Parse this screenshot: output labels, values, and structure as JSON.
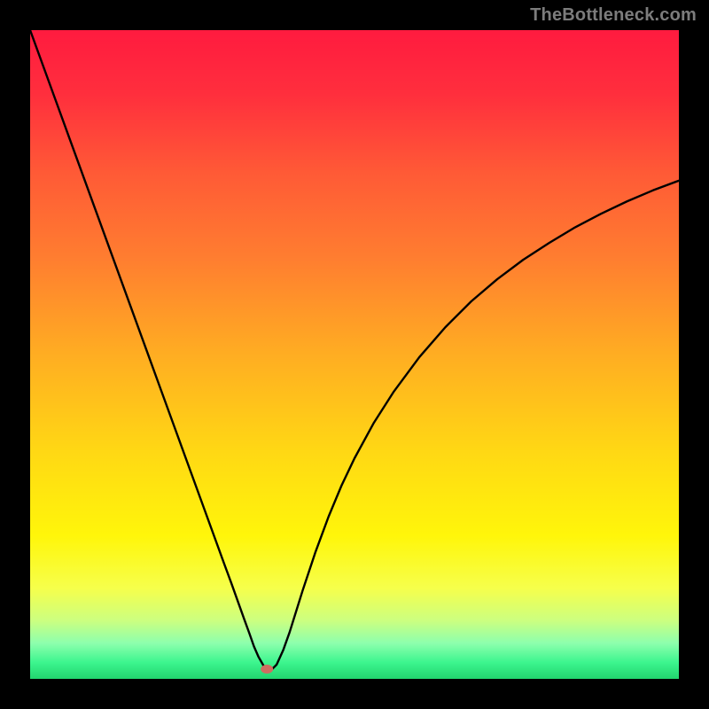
{
  "watermark": "TheBottleneck.com",
  "colors": {
    "frame": "#000000",
    "curve": "#000000",
    "marker": "#cf6d60",
    "gradient_stops": [
      {
        "offset": 0.0,
        "color": "#ff1b3f"
      },
      {
        "offset": 0.1,
        "color": "#ff2f3d"
      },
      {
        "offset": 0.22,
        "color": "#ff5a36"
      },
      {
        "offset": 0.35,
        "color": "#ff7d30"
      },
      {
        "offset": 0.5,
        "color": "#ffad22"
      },
      {
        "offset": 0.65,
        "color": "#ffd814"
      },
      {
        "offset": 0.78,
        "color": "#fff60a"
      },
      {
        "offset": 0.86,
        "color": "#f6ff4b"
      },
      {
        "offset": 0.91,
        "color": "#ccff80"
      },
      {
        "offset": 0.945,
        "color": "#8dffad"
      },
      {
        "offset": 0.975,
        "color": "#3cf58e"
      },
      {
        "offset": 1.0,
        "color": "#22d56e"
      }
    ]
  },
  "chart_data": {
    "type": "line",
    "title": "",
    "xlabel": "",
    "ylabel": "",
    "xlim": [
      0,
      100
    ],
    "ylim": [
      0,
      100
    ],
    "marker": {
      "x": 36.5,
      "y": 1.5
    },
    "series": [
      {
        "name": "bottleneck-curve",
        "x": [
          0,
          2,
          4,
          6,
          8,
          10,
          12,
          14,
          16,
          18,
          20,
          22,
          24,
          26,
          28,
          30,
          31,
          32,
          33,
          33.8,
          34.5,
          35.2,
          36,
          36.5,
          37,
          38,
          39,
          40,
          41,
          42,
          44,
          46,
          48,
          50,
          53,
          56,
          60,
          64,
          68,
          72,
          76,
          80,
          84,
          88,
          92,
          96,
          100
        ],
        "y": [
          100,
          94.5,
          89,
          83.5,
          78,
          72.5,
          67,
          61.5,
          56,
          50.5,
          45,
          39.5,
          34,
          28.5,
          23,
          17.5,
          14.8,
          12,
          9.2,
          7,
          5,
          3.4,
          2,
          1.3,
          1.2,
          2.2,
          4.4,
          7.2,
          10.4,
          13.6,
          19.6,
          25,
          29.8,
          34,
          39.5,
          44.2,
          49.6,
          54.2,
          58.2,
          61.6,
          64.6,
          67.2,
          69.6,
          71.7,
          73.6,
          75.3,
          76.8
        ]
      }
    ]
  }
}
